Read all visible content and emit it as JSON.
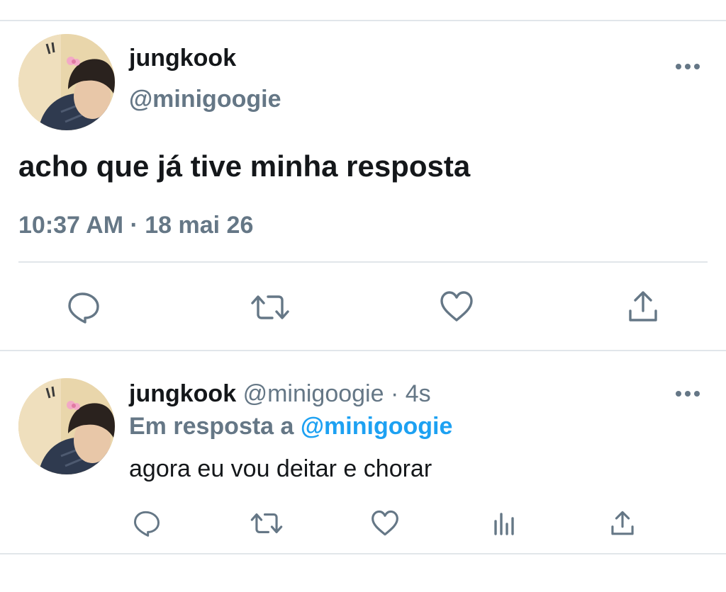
{
  "main_tweet": {
    "display_name": "jungkook",
    "handle": "@minigoogie",
    "text": "acho que já tive minha resposta",
    "timestamp": "10:37 AM · 18 mai 26",
    "more_icon": "more-horizontal-icon",
    "actions": [
      "reply-icon",
      "retweet-icon",
      "like-icon",
      "share-icon"
    ]
  },
  "reply_tweet": {
    "display_name": "jungkook",
    "handle": "@minigoogie",
    "separator": "·",
    "time_ago": "4s",
    "reply_prefix": "Em resposta a",
    "reply_to": "@minigoogie",
    "text": "agora eu vou deitar e chorar",
    "more_icon": "more-horizontal-icon",
    "actions": [
      "reply-icon",
      "retweet-icon",
      "like-icon",
      "analytics-icon",
      "share-icon"
    ]
  },
  "colors": {
    "text": "#14171a",
    "muted": "#657786",
    "accent": "#1da1f2",
    "divider": "#e1e6ea"
  }
}
